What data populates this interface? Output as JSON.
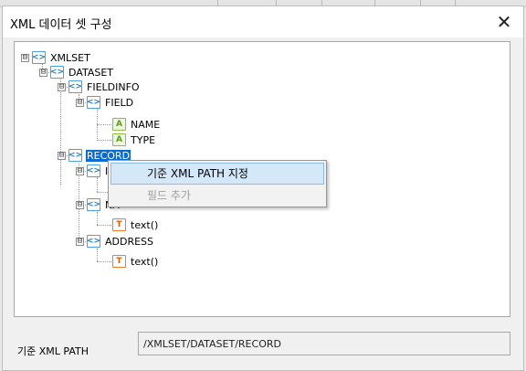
{
  "dialog": {
    "title": "XML 데이터 셋 구성",
    "close_glyph": "✕"
  },
  "tree": {
    "nodes": [
      {
        "label": "XMLSET",
        "icon": "element-icon",
        "icon_glyph": "<>",
        "expander": "⊟"
      },
      {
        "label": "DATASET",
        "icon": "element-icon",
        "icon_glyph": "<>",
        "expander": "⊟"
      },
      {
        "label": "FIELDINFO",
        "icon": "element-icon",
        "icon_glyph": "<>",
        "expander": "⊟"
      },
      {
        "label": "FIELD",
        "icon": "element-icon",
        "icon_glyph": "<>",
        "expander": "⊟"
      },
      {
        "label": "NAME",
        "icon": "attribute-icon",
        "icon_glyph": "A"
      },
      {
        "label": "TYPE",
        "icon": "attribute-icon",
        "icon_glyph": "A"
      },
      {
        "label": "RECORD",
        "icon": "element-icon",
        "icon_glyph": "<>",
        "expander": "⊟",
        "selected": true
      },
      {
        "label": "ID",
        "icon": "element-icon",
        "icon_glyph": "<>",
        "expander": "⊟"
      },
      {
        "label": "",
        "icon": "text-icon",
        "icon_glyph": "T"
      },
      {
        "label": "NA",
        "icon": "element-icon",
        "icon_glyph": "<>",
        "expander": "⊟"
      },
      {
        "label": "text()",
        "icon": "text-icon",
        "icon_glyph": "T"
      },
      {
        "label": "ADDRESS",
        "icon": "element-icon",
        "icon_glyph": "<>",
        "expander": "⊟"
      },
      {
        "label": "text()",
        "icon": "text-icon",
        "icon_glyph": "T"
      }
    ]
  },
  "context_menu": {
    "items": [
      {
        "label": "기준 XML PATH 지정",
        "enabled": true,
        "highlighted": true
      },
      {
        "label": "필드 추가",
        "enabled": false
      }
    ]
  },
  "base_path": {
    "label": "기준 XML PATH",
    "value": "/XMLSET/DATASET/RECORD"
  },
  "colors": {
    "selection": "#0a6cd2",
    "element_icon": "#4aa3df",
    "attribute_icon": "#8cbf3f",
    "text_icon": "#f07c2c",
    "menu_highlight": "#d5e8fa"
  }
}
